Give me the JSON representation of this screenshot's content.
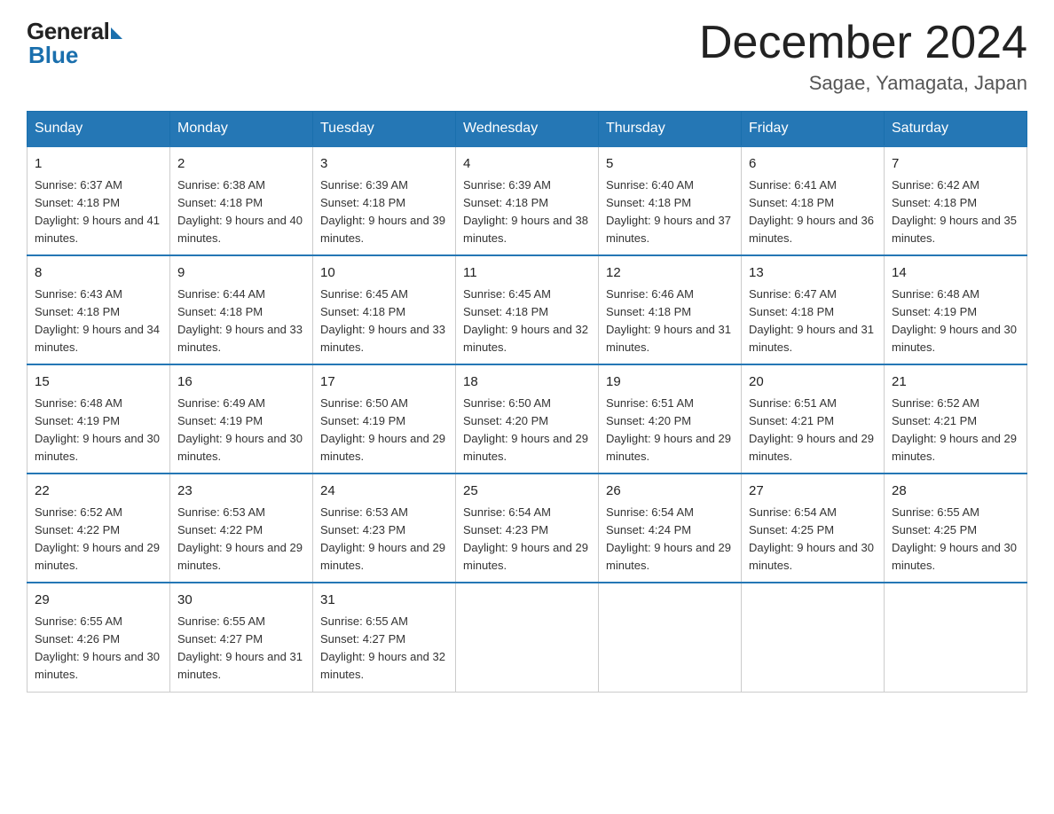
{
  "header": {
    "logo_general": "General",
    "logo_blue": "Blue",
    "month_title": "December 2024",
    "location": "Sagae, Yamagata, Japan"
  },
  "days_of_week": [
    "Sunday",
    "Monday",
    "Tuesday",
    "Wednesday",
    "Thursday",
    "Friday",
    "Saturday"
  ],
  "weeks": [
    [
      {
        "day": "1",
        "sunrise": "6:37 AM",
        "sunset": "4:18 PM",
        "daylight": "9 hours and 41 minutes."
      },
      {
        "day": "2",
        "sunrise": "6:38 AM",
        "sunset": "4:18 PM",
        "daylight": "9 hours and 40 minutes."
      },
      {
        "day": "3",
        "sunrise": "6:39 AM",
        "sunset": "4:18 PM",
        "daylight": "9 hours and 39 minutes."
      },
      {
        "day": "4",
        "sunrise": "6:39 AM",
        "sunset": "4:18 PM",
        "daylight": "9 hours and 38 minutes."
      },
      {
        "day": "5",
        "sunrise": "6:40 AM",
        "sunset": "4:18 PM",
        "daylight": "9 hours and 37 minutes."
      },
      {
        "day": "6",
        "sunrise": "6:41 AM",
        "sunset": "4:18 PM",
        "daylight": "9 hours and 36 minutes."
      },
      {
        "day": "7",
        "sunrise": "6:42 AM",
        "sunset": "4:18 PM",
        "daylight": "9 hours and 35 minutes."
      }
    ],
    [
      {
        "day": "8",
        "sunrise": "6:43 AM",
        "sunset": "4:18 PM",
        "daylight": "9 hours and 34 minutes."
      },
      {
        "day": "9",
        "sunrise": "6:44 AM",
        "sunset": "4:18 PM",
        "daylight": "9 hours and 33 minutes."
      },
      {
        "day": "10",
        "sunrise": "6:45 AM",
        "sunset": "4:18 PM",
        "daylight": "9 hours and 33 minutes."
      },
      {
        "day": "11",
        "sunrise": "6:45 AM",
        "sunset": "4:18 PM",
        "daylight": "9 hours and 32 minutes."
      },
      {
        "day": "12",
        "sunrise": "6:46 AM",
        "sunset": "4:18 PM",
        "daylight": "9 hours and 31 minutes."
      },
      {
        "day": "13",
        "sunrise": "6:47 AM",
        "sunset": "4:18 PM",
        "daylight": "9 hours and 31 minutes."
      },
      {
        "day": "14",
        "sunrise": "6:48 AM",
        "sunset": "4:19 PM",
        "daylight": "9 hours and 30 minutes."
      }
    ],
    [
      {
        "day": "15",
        "sunrise": "6:48 AM",
        "sunset": "4:19 PM",
        "daylight": "9 hours and 30 minutes."
      },
      {
        "day": "16",
        "sunrise": "6:49 AM",
        "sunset": "4:19 PM",
        "daylight": "9 hours and 30 minutes."
      },
      {
        "day": "17",
        "sunrise": "6:50 AM",
        "sunset": "4:19 PM",
        "daylight": "9 hours and 29 minutes."
      },
      {
        "day": "18",
        "sunrise": "6:50 AM",
        "sunset": "4:20 PM",
        "daylight": "9 hours and 29 minutes."
      },
      {
        "day": "19",
        "sunrise": "6:51 AM",
        "sunset": "4:20 PM",
        "daylight": "9 hours and 29 minutes."
      },
      {
        "day": "20",
        "sunrise": "6:51 AM",
        "sunset": "4:21 PM",
        "daylight": "9 hours and 29 minutes."
      },
      {
        "day": "21",
        "sunrise": "6:52 AM",
        "sunset": "4:21 PM",
        "daylight": "9 hours and 29 minutes."
      }
    ],
    [
      {
        "day": "22",
        "sunrise": "6:52 AM",
        "sunset": "4:22 PM",
        "daylight": "9 hours and 29 minutes."
      },
      {
        "day": "23",
        "sunrise": "6:53 AM",
        "sunset": "4:22 PM",
        "daylight": "9 hours and 29 minutes."
      },
      {
        "day": "24",
        "sunrise": "6:53 AM",
        "sunset": "4:23 PM",
        "daylight": "9 hours and 29 minutes."
      },
      {
        "day": "25",
        "sunrise": "6:54 AM",
        "sunset": "4:23 PM",
        "daylight": "9 hours and 29 minutes."
      },
      {
        "day": "26",
        "sunrise": "6:54 AM",
        "sunset": "4:24 PM",
        "daylight": "9 hours and 29 minutes."
      },
      {
        "day": "27",
        "sunrise": "6:54 AM",
        "sunset": "4:25 PM",
        "daylight": "9 hours and 30 minutes."
      },
      {
        "day": "28",
        "sunrise": "6:55 AM",
        "sunset": "4:25 PM",
        "daylight": "9 hours and 30 minutes."
      }
    ],
    [
      {
        "day": "29",
        "sunrise": "6:55 AM",
        "sunset": "4:26 PM",
        "daylight": "9 hours and 30 minutes."
      },
      {
        "day": "30",
        "sunrise": "6:55 AM",
        "sunset": "4:27 PM",
        "daylight": "9 hours and 31 minutes."
      },
      {
        "day": "31",
        "sunrise": "6:55 AM",
        "sunset": "4:27 PM",
        "daylight": "9 hours and 32 minutes."
      },
      null,
      null,
      null,
      null
    ]
  ]
}
